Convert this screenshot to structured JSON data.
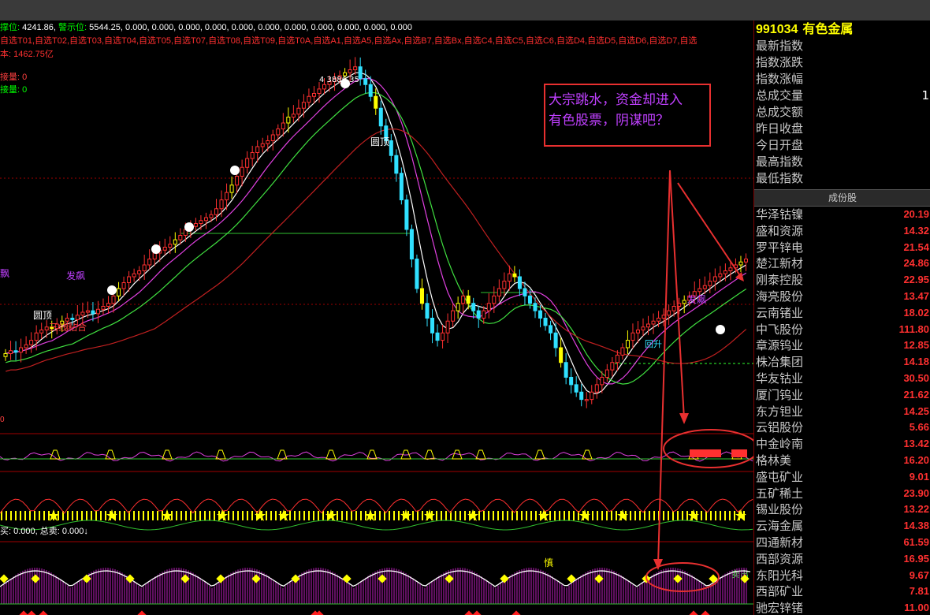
{
  "header": {
    "support_label": "撑位:",
    "support_value": "4241.86,",
    "warn_label": "警示位:",
    "warn_values": "5544.25, 0.000, 0.000, 0.000, 0.000, 0.000, 0.000, 0.000, 0.000, 0.000, 0.000, 0.000",
    "selections": "自选T01,自选T02,自选T03,自选T04,自选T05,自选T07,自选T08,自选T09,自选T0A,自选A1,自选A5,自选Ax,自选B7,自选Bx,自选C4,自选C5,自选C6,自选D4,自选D5,自选D6,自选D7,自选",
    "cost": "本: 1462.75亿",
    "vol_red": "接量: 0",
    "vol_green": "接量: 0",
    "low_panel_info": "买: 0.000, 总卖: 0.000↓",
    "panel2_label": "0"
  },
  "annotation": {
    "line1": "大宗跳水，资金却进入",
    "line2": "有色股票，阴谋吧？"
  },
  "chart_labels": {
    "peak": "4  3886.35",
    "round_top_1": "圆顶",
    "round_top_2": "圆顶",
    "three_line": "三线粘合",
    "fa_piao_1": "发飙",
    "fa_piao_2": "发飙",
    "piao": "飘",
    "break_box": "回升",
    "shen": "慎",
    "sell_label": "卖出"
  },
  "right_panel": {
    "code": "991034",
    "name": "有色金属",
    "stats": [
      {
        "label": "最新指数",
        "value": ""
      },
      {
        "label": "指数涨跌",
        "value": ""
      },
      {
        "label": "指数涨幅",
        "value": ""
      },
      {
        "label": "总成交量",
        "value": "1"
      },
      {
        "label": "总成交额",
        "value": ""
      },
      {
        "label": "昨日收盘",
        "value": ""
      },
      {
        "label": "今日开盘",
        "value": ""
      },
      {
        "label": "最高指数",
        "value": ""
      },
      {
        "label": "最低指数",
        "value": ""
      }
    ],
    "components_header": "成份股",
    "components": [
      {
        "name": "华泽钴镍",
        "price": "20.19"
      },
      {
        "name": "盛和资源",
        "price": "14.32"
      },
      {
        "name": "罗平锌电",
        "price": "21.54"
      },
      {
        "name": "楚江新材",
        "price": "24.86"
      },
      {
        "name": "刚泰控股",
        "price": "22.95"
      },
      {
        "name": "海亮股份",
        "price": "13.47"
      },
      {
        "name": "云南锗业",
        "price": "18.02"
      },
      {
        "name": "中飞股份",
        "price": "111.80"
      },
      {
        "name": "章源钨业",
        "price": "12.85"
      },
      {
        "name": "株冶集团",
        "price": "14.18"
      },
      {
        "name": "华友钴业",
        "price": "30.50"
      },
      {
        "name": "厦门钨业",
        "price": "21.62"
      },
      {
        "name": "东方钽业",
        "price": "14.25"
      },
      {
        "name": "云铝股份",
        "price": "5.66"
      },
      {
        "name": "中金岭南",
        "price": "13.42"
      },
      {
        "name": "格林美",
        "price": "16.20"
      },
      {
        "name": "盛屯矿业",
        "price": "9.01"
      },
      {
        "name": "五矿稀土",
        "price": "23.90"
      },
      {
        "name": "锡业股份",
        "price": "13.22"
      },
      {
        "name": "云海金属",
        "price": "14.38"
      },
      {
        "name": "四通新材",
        "price": "61.59"
      },
      {
        "name": "西部资源",
        "price": "16.95"
      },
      {
        "name": "东阳光科",
        "price": "9.67"
      },
      {
        "name": "西部矿业",
        "price": "7.81"
      },
      {
        "name": "驰宏锌锗",
        "price": "11.00"
      }
    ]
  },
  "chart_data": {
    "type": "candlestick",
    "title": "",
    "close_values": [
      3560,
      3580,
      3570,
      3600,
      3620,
      3650,
      3700,
      3720,
      3740,
      3730,
      3760,
      3780,
      3800,
      3790,
      3820,
      3840,
      3850,
      3830,
      3860,
      3880,
      3900,
      3950,
      4000,
      4040,
      4080,
      4100,
      4120,
      4160,
      4200,
      4240,
      4260,
      4280,
      4300,
      4330,
      4360,
      4400,
      4420,
      4440,
      4460,
      4480,
      4500,
      4540,
      4600,
      4650,
      4700,
      4760,
      4820,
      4880,
      4920,
      4960,
      4980,
      5000,
      5040,
      5080,
      5120,
      5160,
      5180,
      5220,
      5260,
      5300,
      5320,
      5350,
      5380,
      5400,
      5420,
      5440,
      5460,
      5480,
      5500,
      5420,
      5380,
      5300,
      5220,
      5100,
      5000,
      4900,
      4780,
      4600,
      4400,
      4200,
      4000,
      3900,
      3800,
      3700,
      3650,
      3700,
      3780,
      3850,
      3900,
      3950,
      3900,
      3850,
      3800,
      3850,
      3900,
      3950,
      4000,
      4050,
      4100,
      4080,
      4000,
      3950,
      3900,
      3850,
      3800,
      3750,
      3700,
      3600,
      3500,
      3400,
      3350,
      3300,
      3250,
      3250,
      3300,
      3350,
      3400,
      3450,
      3500,
      3550,
      3600,
      3650,
      3700,
      3720,
      3740,
      3760,
      3780,
      3800,
      3820,
      3850,
      3880,
      3900,
      3920,
      3950,
      3980,
      4000,
      4020,
      4050,
      4080,
      4100,
      4120,
      4140,
      4160,
      4180,
      4200
    ],
    "ma_short_label": "",
    "ma_long_label": "",
    "resistance_level": 4241.86,
    "warn_level": 5544.25
  }
}
